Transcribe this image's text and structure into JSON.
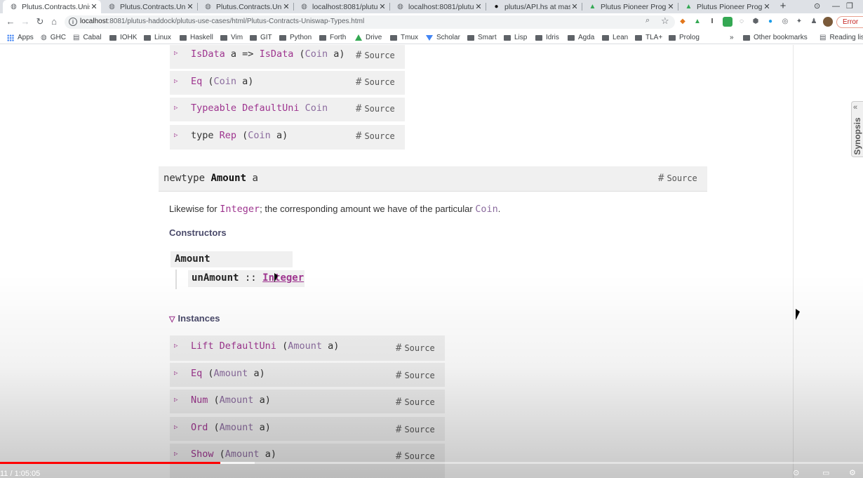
{
  "browser": {
    "tabs": [
      {
        "title": "Plutus.Contracts.Unis",
        "favicon": "globe-icon",
        "active": true
      },
      {
        "title": "Plutus.Contracts.Unis",
        "favicon": "globe-icon",
        "active": false
      },
      {
        "title": "Plutus.Contracts.Unis",
        "favicon": "globe-icon",
        "active": false
      },
      {
        "title": "localhost:8081/plutu",
        "favicon": "globe-icon",
        "active": false
      },
      {
        "title": "localhost:8081/plutu",
        "favicon": "globe-icon",
        "active": false
      },
      {
        "title": "plutus/API.hs at mas",
        "favicon": "github-icon",
        "active": false
      },
      {
        "title": "Plutus Pioneer Progr",
        "favicon": "drive-icon",
        "active": false
      },
      {
        "title": "Plutus Pioneer Progr",
        "favicon": "drive-icon",
        "active": false
      }
    ],
    "new_tab_symbol": "+",
    "url_host": "localhost",
    "url_rest": ":8081/plutus-haddock/plutus-use-cases/html/Plutus-Contracts-Uniswap-Types.html",
    "error_label": "Error",
    "bookmarks": [
      {
        "label": "Apps",
        "icon": "apps-icon"
      },
      {
        "label": "GHC",
        "icon": "globe-icon"
      },
      {
        "label": "Cabal",
        "icon": "book-icon"
      },
      {
        "label": "IOHK",
        "icon": "folder-icon"
      },
      {
        "label": "Linux",
        "icon": "folder-icon"
      },
      {
        "label": "Haskell",
        "icon": "folder-icon"
      },
      {
        "label": "Vim",
        "icon": "folder-icon"
      },
      {
        "label": "GIT",
        "icon": "folder-icon"
      },
      {
        "label": "Python",
        "icon": "folder-icon"
      },
      {
        "label": "Forth",
        "icon": "folder-icon"
      },
      {
        "label": "Drive",
        "icon": "drive-icon"
      },
      {
        "label": "Tmux",
        "icon": "folder-icon"
      },
      {
        "label": "Scholar",
        "icon": "scholar-icon"
      },
      {
        "label": "Smart",
        "icon": "folder-icon"
      },
      {
        "label": "Lisp",
        "icon": "folder-icon"
      },
      {
        "label": "Idris",
        "icon": "folder-icon"
      },
      {
        "label": "Agda",
        "icon": "folder-icon"
      },
      {
        "label": "Lean",
        "icon": "folder-icon"
      },
      {
        "label": "TLA+",
        "icon": "folder-icon"
      },
      {
        "label": "Prolog",
        "icon": "folder-icon"
      }
    ],
    "bookmarks_overflow": "»",
    "other_bookmarks": "Other bookmarks",
    "reading_list": "Reading list"
  },
  "doc": {
    "coin_instances": [
      {
        "class": "IsData",
        "rest_prefix": " a => ",
        "class2": "IsData",
        "args": [
          " (",
          "Coin",
          " a)"
        ]
      },
      {
        "class": "Eq",
        "args": [
          " (",
          "Coin",
          " a)"
        ]
      },
      {
        "class": "Typeable",
        "args": [
          " ",
          "DefaultUni",
          " ",
          "Coin"
        ]
      },
      {
        "prefix": "type ",
        "class": "Rep",
        "args": [
          " (",
          "Coin",
          " a)"
        ]
      }
    ],
    "source_label": "Source",
    "hash": "#",
    "newtype_kw": "newtype",
    "newtype_name": "Amount",
    "newtype_arg": "a",
    "description_1": "Likewise for ",
    "description_type": "Integer",
    "description_2": "; the corresponding amount we have of the particular ",
    "description_coin": "Coin",
    "description_3": ".",
    "constructors_heading": "Constructors",
    "constructor_name": "Amount",
    "field_name": "unAmount",
    "field_sep": " :: ",
    "field_type": "Integer",
    "instances_heading": "Instances",
    "amount_instances": [
      {
        "class": "Lift",
        "args": [
          " ",
          "DefaultUni",
          " (",
          "Amount",
          " a)"
        ]
      },
      {
        "class": "Eq",
        "args": [
          " (",
          "Amount",
          " a)"
        ]
      },
      {
        "class": "Num",
        "args": [
          " (",
          "Amount",
          " a)"
        ]
      },
      {
        "class": "Ord",
        "args": [
          " (",
          "Amount",
          " a)"
        ]
      },
      {
        "class": "Show",
        "args": [
          " (",
          "Amount",
          " a)"
        ]
      }
    ],
    "synopsis_label": "Synopsis"
  },
  "player": {
    "time": "11 / 1:05:05",
    "progress_fraction": 0.255,
    "buffered_fraction": 0.295
  }
}
